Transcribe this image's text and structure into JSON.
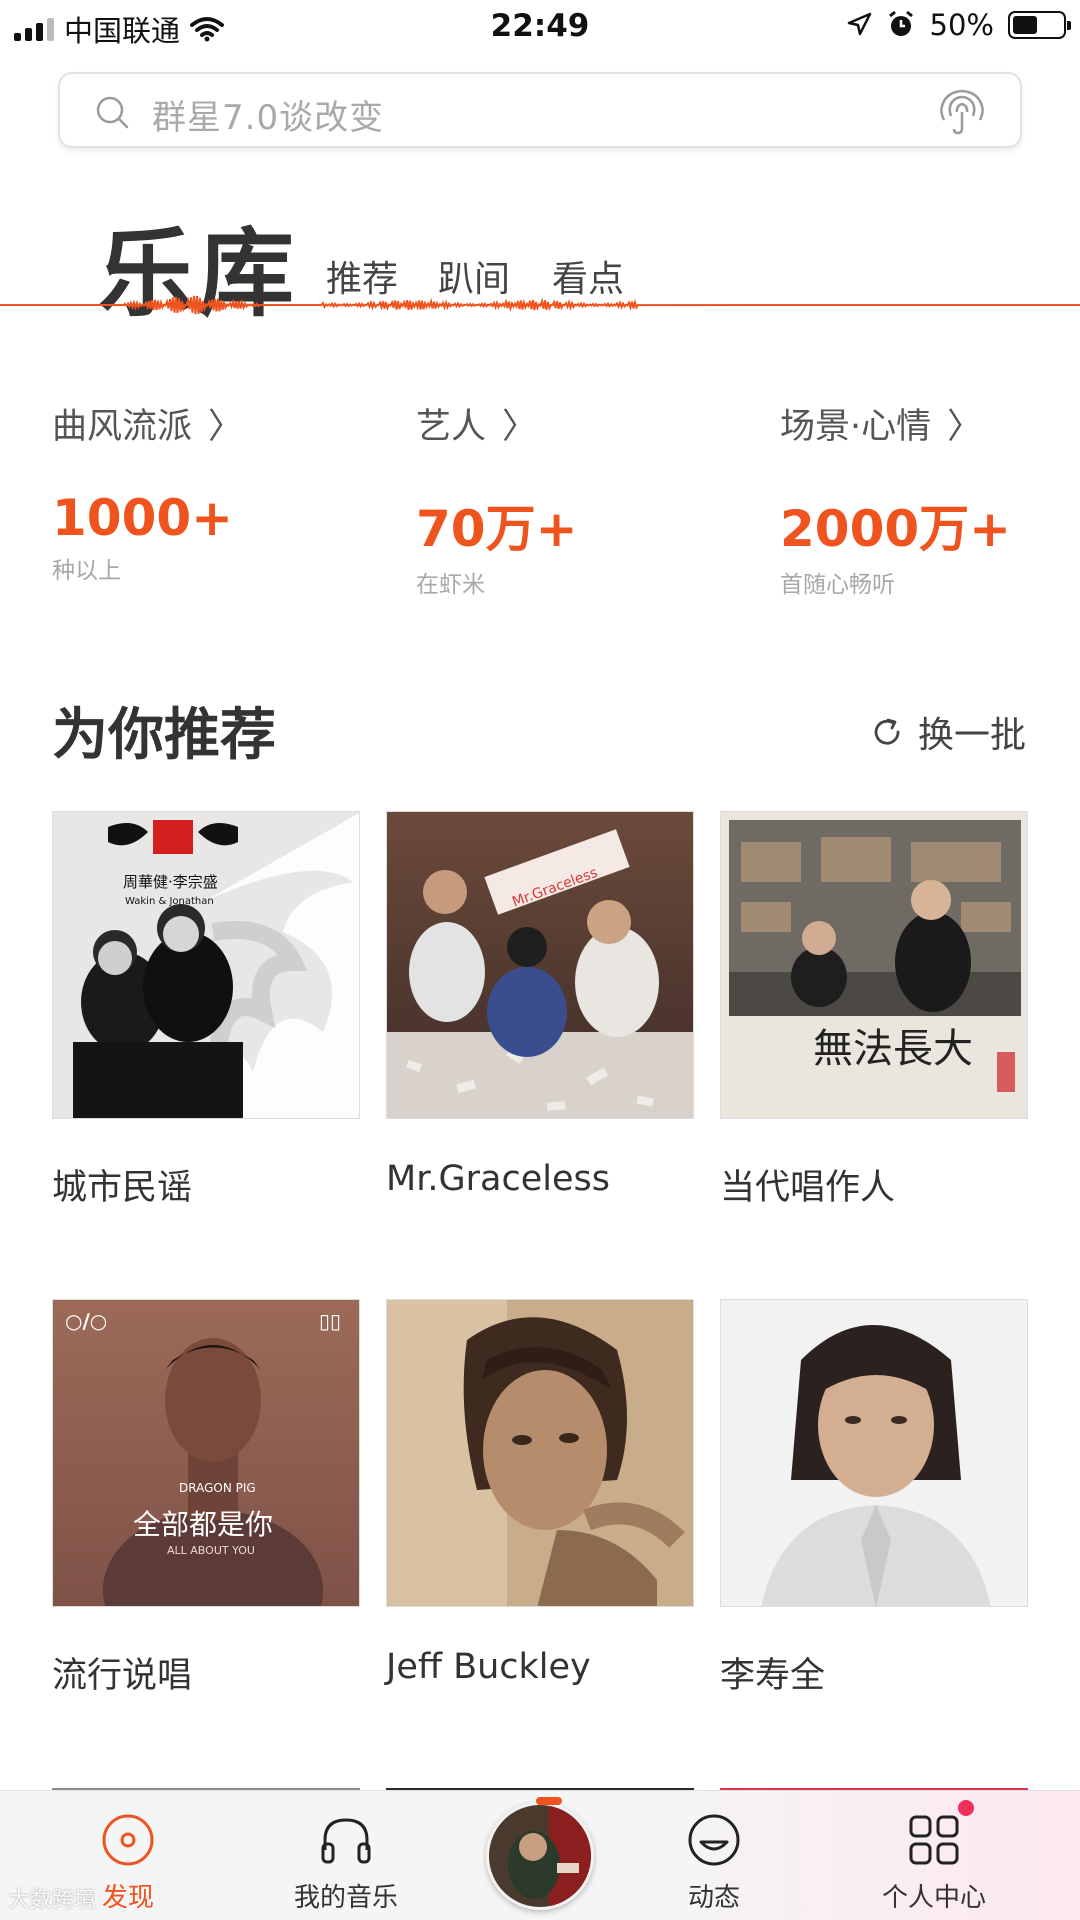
{
  "status_bar": {
    "carrier": "中国联通",
    "time": "22:49",
    "battery": "50%",
    "battery_level": 0.5
  },
  "search": {
    "placeholder": "群星7.0谈改变"
  },
  "tabs": {
    "active": "乐库",
    "items": [
      "推荐",
      "趴间",
      "看点"
    ]
  },
  "stats": [
    {
      "label": "曲风流派",
      "value": "1000+",
      "sub": "种以上"
    },
    {
      "label": "艺人",
      "value": "70万+",
      "sub": "在虾米"
    },
    {
      "label": "场景·心情",
      "value": "2000万+",
      "sub": "首随心畅听"
    }
  ],
  "recommend": {
    "title": "为你推荐",
    "refresh_label": "换一批",
    "cards": [
      {
        "label": "城市民谣",
        "cover_text": "周華健·李宗盛",
        "cover_sub": "Wakin & Jonathan"
      },
      {
        "label": "Mr.Graceless",
        "cover_text": "Mr.Graceless"
      },
      {
        "label": "当代唱作人",
        "cover_text": "無法長大"
      },
      {
        "label": "流行说唱",
        "cover_text": "全部都是你",
        "cover_sub": "ALL ABOUT YOU",
        "cover_tag": "DRAGON PIG"
      },
      {
        "label": "Jeff Buckley"
      },
      {
        "label": "李寿全"
      }
    ]
  },
  "nav": {
    "items": [
      {
        "label": "发现",
        "icon": "disc-icon",
        "active": true
      },
      {
        "label": "我的音乐",
        "icon": "headphones-icon"
      },
      {
        "label": "动态",
        "icon": "smile-face-icon"
      },
      {
        "label": "个人中心",
        "icon": "grid-icon"
      }
    ]
  },
  "watermark": "大数跨境",
  "colors": {
    "accent": "#f0541e",
    "badge": "#f0305a"
  }
}
